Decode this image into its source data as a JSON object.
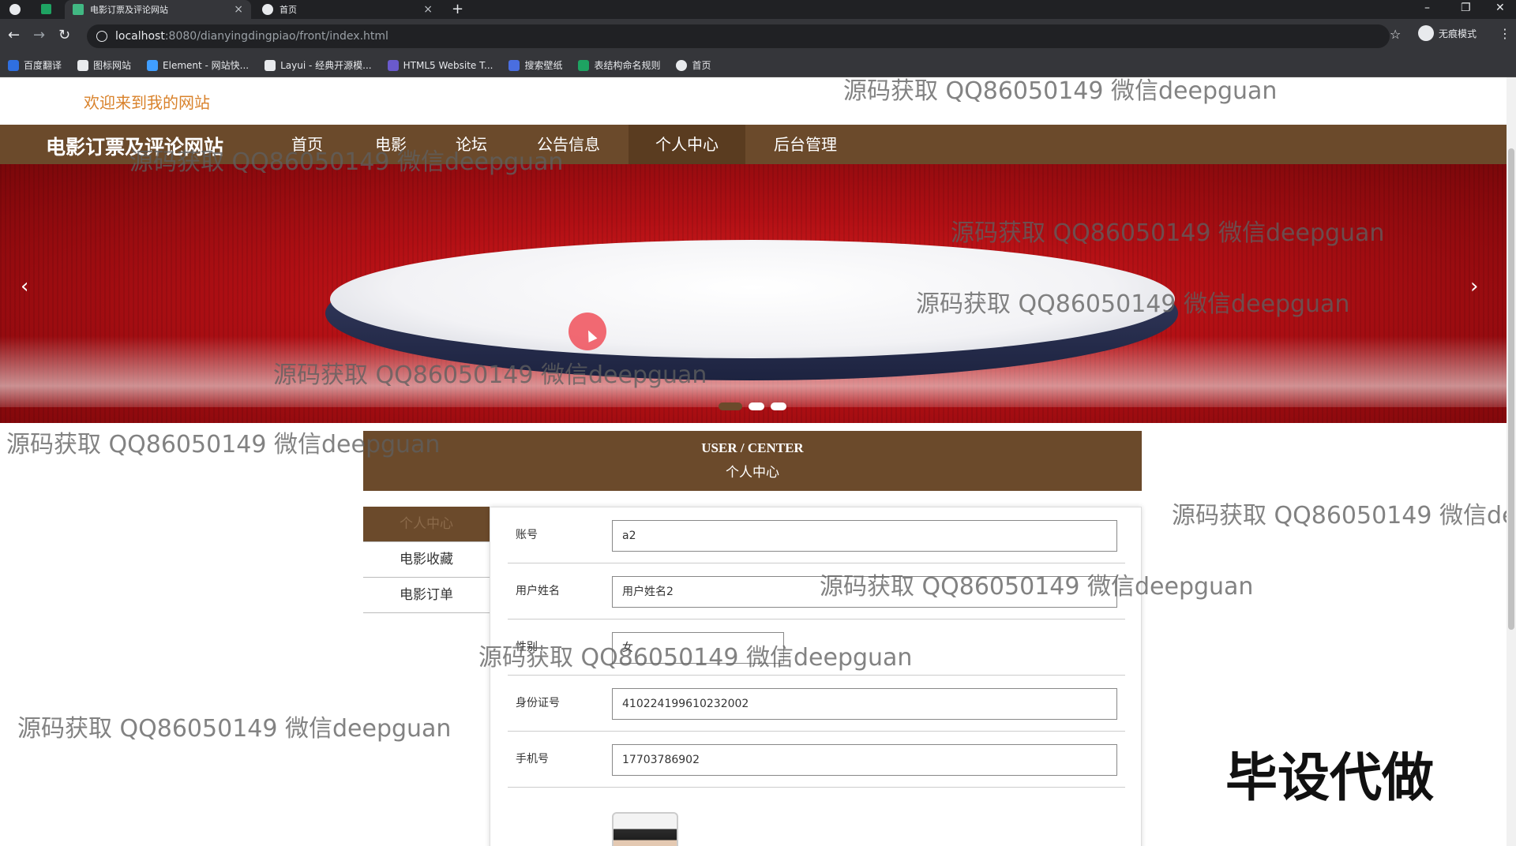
{
  "browser": {
    "tabs": [
      {
        "title": "电影订票及评论网站",
        "close": "×"
      },
      {
        "title": "首页",
        "close": "×"
      }
    ],
    "new_tab": "+",
    "window_controls": {
      "minimize": "–",
      "restore": "❐",
      "close": "✕"
    },
    "nav": {
      "back": "←",
      "forward": "→",
      "reload": "↻"
    },
    "url_host": "localhost",
    "url_path": ":8080/dianyingdingpiao/front/index.html",
    "bookmark_star": "☆",
    "profile_label": "无痕模式",
    "menu": "⋮",
    "bookmarks": [
      {
        "label": "百度翻译",
        "color": "#2f6fe0"
      },
      {
        "label": "图标网站",
        "color": "#e8eaed"
      },
      {
        "label": "Element - 网站快...",
        "color": "#409eff"
      },
      {
        "label": "Layui - 经典开源模...",
        "color": "#e8eaed"
      },
      {
        "label": "HTML5 Website T...",
        "color": "#6a5acd"
      },
      {
        "label": "搜索壁纸",
        "color": "#4a6ee0"
      },
      {
        "label": "表结构命名规则",
        "color": "#1ea362"
      },
      {
        "label": "首页",
        "color": "#e8eaed"
      }
    ]
  },
  "header": {
    "welcome": "欢迎来到我的网站",
    "brand": "电影订票及评论网站",
    "nav": [
      "首页",
      "电影",
      "论坛",
      "公告信息",
      "个人中心",
      "后台管理"
    ],
    "active_nav_index": 4
  },
  "banner": {
    "prev": "‹",
    "next": "›",
    "slides_count": 3,
    "active_slide": 0
  },
  "user_center": {
    "title_en": "USER / CENTER",
    "title_cn": "个人中心",
    "sidebar": [
      "个人中心",
      "电影收藏",
      "电影订单"
    ],
    "form": {
      "account_label": "账号",
      "account_value": "a2",
      "name_label": "用户姓名",
      "name_value": "用户姓名2",
      "gender_label": "性别",
      "gender_value": "女",
      "idcard_label": "身份证号",
      "idcard_value": "410224199610232002",
      "phone_label": "手机号",
      "phone_value": "17703786902"
    }
  },
  "watermarks": {
    "text": "源码获取 QQ86050149 微信deepguan",
    "text_cut": "源码获取 QQ86050149 微信dee",
    "big": "毕设代做"
  },
  "colors": {
    "nav_brown": "#6b4a2b",
    "welcome_orange": "#d9822b",
    "banner_red": "#b10f14"
  }
}
